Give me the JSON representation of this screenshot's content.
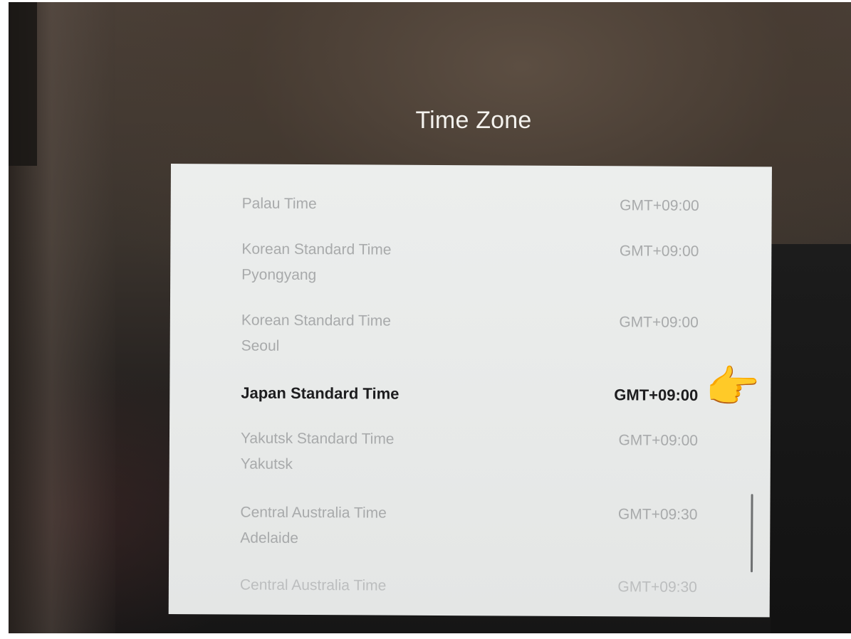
{
  "dialog": {
    "title": "Time Zone"
  },
  "time_zones": [
    {
      "name": "Palau Time",
      "city": "",
      "offset": "GMT+09:00",
      "selected": false
    },
    {
      "name": "Korean Standard Time",
      "city": "Pyongyang",
      "offset": "GMT+09:00",
      "selected": false
    },
    {
      "name": "Korean Standard Time",
      "city": "Seoul",
      "offset": "GMT+09:00",
      "selected": false
    },
    {
      "name": "Japan Standard Time",
      "city": "",
      "offset": "GMT+09:00",
      "selected": true
    },
    {
      "name": "Yakutsk Standard Time",
      "city": "Yakutsk",
      "offset": "GMT+09:00",
      "selected": false
    },
    {
      "name": "Central Australia Time",
      "city": "Adelaide",
      "offset": "GMT+09:30",
      "selected": false
    },
    {
      "name": "Central Australia Time",
      "city": "",
      "offset": "GMT+09:30",
      "selected": false
    }
  ],
  "pointer": {
    "icon": "pointing-hand-icon",
    "glyph": "👉"
  },
  "colors": {
    "panel_background": "#eceeed",
    "selected_text": "#1d1d1f",
    "unselected_text": "#a8aaab",
    "title_text": "#f4f2ee"
  }
}
